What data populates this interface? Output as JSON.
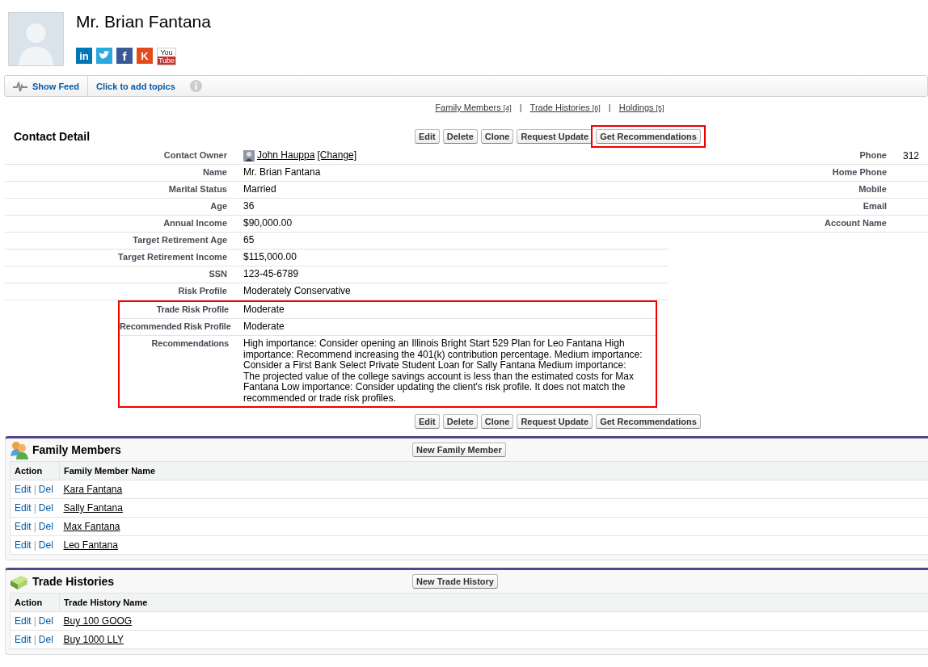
{
  "header": {
    "name": "Mr. Brian Fantana",
    "social": [
      {
        "kind": "linkedin",
        "glyph": "in"
      },
      {
        "kind": "twitter"
      },
      {
        "kind": "facebook",
        "glyph": "f"
      },
      {
        "kind": "klout",
        "glyph": "K"
      },
      {
        "kind": "youtube",
        "glyph": "You",
        "glyph2": "Tube"
      }
    ]
  },
  "feed_bar": {
    "show_feed": "Show Feed",
    "topics": "Click to add topics"
  },
  "related_links": [
    {
      "kind": "link",
      "label": "Family Members",
      "count": "[4]"
    },
    {
      "kind": "separator",
      "label": "|"
    },
    {
      "kind": "link",
      "label": "Trade Histories",
      "count": "[6]"
    },
    {
      "kind": "separator",
      "label": "|"
    },
    {
      "kind": "link",
      "label": "Holdings",
      "count": "[5]"
    }
  ],
  "contact_detail": {
    "title": "Contact Detail",
    "buttons": [
      {
        "label": "Edit",
        "highlighted": false
      },
      {
        "label": "Delete",
        "highlighted": false
      },
      {
        "label": "Clone",
        "highlighted": false
      },
      {
        "label": "Request Update",
        "highlighted": false
      },
      {
        "label": "Get Recommendations",
        "highlighted": true
      }
    ],
    "left_fields": [
      {
        "kind": "owner",
        "label": "Contact Owner",
        "value": "John Hauppa",
        "action": "[Change]",
        "highlighted": false
      },
      {
        "kind": "text",
        "label": "Name",
        "value": "Mr. Brian Fantana",
        "highlighted": false
      },
      {
        "kind": "text",
        "label": "Marital Status",
        "value": "Married",
        "highlighted": false
      },
      {
        "kind": "text",
        "label": "Age",
        "value": "36",
        "highlighted": false
      },
      {
        "kind": "text",
        "label": "Annual Income",
        "value": "$90,000.00",
        "highlighted": false
      },
      {
        "kind": "text",
        "label": "Target Retirement Age",
        "value": "65",
        "highlighted": false
      },
      {
        "kind": "text",
        "label": "Target Retirement Income",
        "value": "$115,000.00",
        "highlighted": false
      },
      {
        "kind": "text",
        "label": "SSN",
        "value": "123-45-6789",
        "highlighted": false
      },
      {
        "kind": "text",
        "label": "Risk Profile",
        "value": "Moderately Conservative",
        "highlighted": false
      },
      {
        "kind": "text",
        "label": "Trade Risk Profile",
        "value": "Moderate",
        "highlighted": true
      },
      {
        "kind": "text",
        "label": "Recommended Risk Profile",
        "value": "Moderate",
        "highlighted": true
      },
      {
        "kind": "text",
        "label": "Recommendations",
        "value": "High importance: Consider opening an Illinois Bright Start 529 Plan for Leo Fantana High importance: Recommend increasing the 401(k) contribution percentage. Medium importance: Consider a First Bank Select Private Student Loan for Sally Fantana Medium importance: The projected value of the college savings account is less than the estimated costs for Max Fantana Low importance: Consider updating the client's risk profile. It does not match the recommended or trade risk profiles.",
        "highlighted": true
      }
    ],
    "right_fields": [
      {
        "label": "Phone",
        "value": "312"
      },
      {
        "label": "Home Phone"
      },
      {
        "label": "Mobile"
      },
      {
        "label": "Email"
      },
      {
        "label": "Account Name"
      }
    ],
    "bottom_buttons": [
      {
        "label": "Edit",
        "highlighted": false
      },
      {
        "label": "Delete",
        "highlighted": false
      },
      {
        "label": "Clone",
        "highlighted": false
      },
      {
        "label": "Request Update",
        "highlighted": false
      },
      {
        "label": "Get Recommendations",
        "highlighted": false
      }
    ]
  },
  "related_lists": [
    {
      "kind": "family",
      "title": "Family Members",
      "button": "New Family Member",
      "columns": [
        "Action",
        "Family Member Name"
      ],
      "rows": [
        {
          "edit": "Edit",
          "separator": "|",
          "del": "Del",
          "name": "Kara Fantana"
        },
        {
          "edit": "Edit",
          "separator": "|",
          "del": "Del",
          "name": "Sally Fantana"
        },
        {
          "edit": "Edit",
          "separator": "|",
          "del": "Del",
          "name": "Max Fantana"
        },
        {
          "edit": "Edit",
          "separator": "|",
          "del": "Del",
          "name": "Leo Fantana"
        }
      ]
    },
    {
      "kind": "trade",
      "title": "Trade Histories",
      "button": "New Trade History",
      "columns": [
        "Action",
        "Trade History Name"
      ],
      "rows": [
        {
          "edit": "Edit",
          "separator": "|",
          "del": "Del",
          "name": "Buy 100 GOOG"
        },
        {
          "edit": "Edit",
          "separator": "|",
          "del": "Del",
          "name": "Buy 1000 LLY"
        }
      ]
    }
  ]
}
